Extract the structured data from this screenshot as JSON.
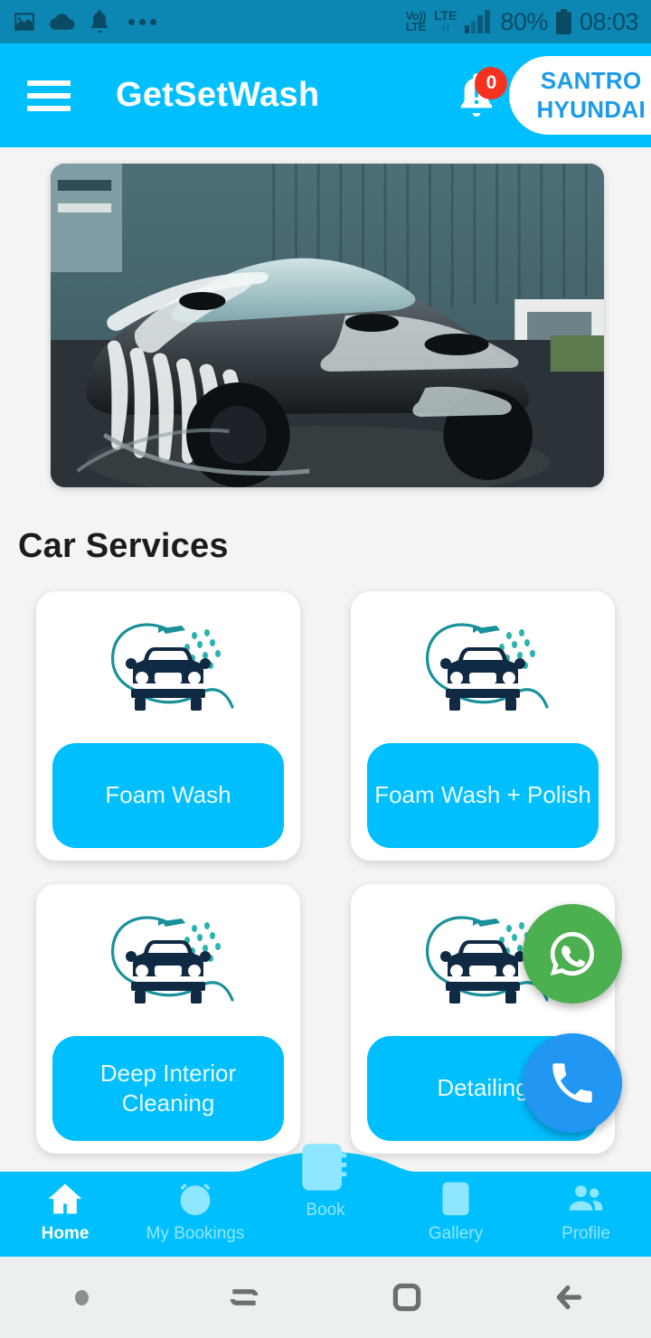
{
  "status_bar": {
    "icons": [
      "image-icon",
      "cloud-icon",
      "bell-icon",
      "more-dots-icon"
    ],
    "volte_line1": "Vo))",
    "volte_line2": "LTE",
    "network_type": "LTE",
    "network_arrows": "↓↑",
    "signal": "signal-bars-icon",
    "battery_percent": "80%",
    "battery_icon": "battery-icon",
    "time": "08:03"
  },
  "header": {
    "menu_icon": "hamburger-menu-icon",
    "title": "GetSetWash",
    "notification_icon": "bell-alert-icon",
    "notification_count": "0",
    "vehicle_line1": "SANTRO",
    "vehicle_line2": "HYUNDAI",
    "bg_color": "#00bfff",
    "badge_color": "#f4321f",
    "vehicle_text_color": "#1b9be8"
  },
  "hero": {
    "alt": "foamed-black-sports-car-photo"
  },
  "main": {
    "section_title": "Car Services",
    "services": [
      {
        "label": "Foam Wash",
        "icon": "car-wash-icon"
      },
      {
        "label": "Foam Wash + Polish",
        "icon": "car-wash-icon"
      },
      {
        "label": "Deep Interior Cleaning",
        "icon": "car-wash-icon"
      },
      {
        "label": "Detailing",
        "icon": "car-wash-icon"
      }
    ]
  },
  "fabs": [
    {
      "name": "whatsapp-fab",
      "icon": "whatsapp-icon",
      "color": "#4caf50"
    },
    {
      "name": "call-fab",
      "icon": "phone-icon",
      "color": "#2196f3"
    }
  ],
  "bottom_nav": {
    "bg_color": "#00bfff",
    "active_color": "#ffffff",
    "inactive_color": "#8fe6ff",
    "items": [
      {
        "label": "Home",
        "icon": "home-icon",
        "active": true
      },
      {
        "label": "My Bookings",
        "icon": "clock-icon",
        "active": false
      },
      {
        "label": "Book",
        "icon": "notebook-icon",
        "active": false
      },
      {
        "label": "Gallery",
        "icon": "image-icon",
        "active": false
      },
      {
        "label": "Profile",
        "icon": "people-icon",
        "active": false
      }
    ]
  },
  "android_nav": {
    "buttons": [
      "dot-indicator",
      "recents-icon",
      "home-square-icon",
      "back-arrow-icon"
    ]
  }
}
